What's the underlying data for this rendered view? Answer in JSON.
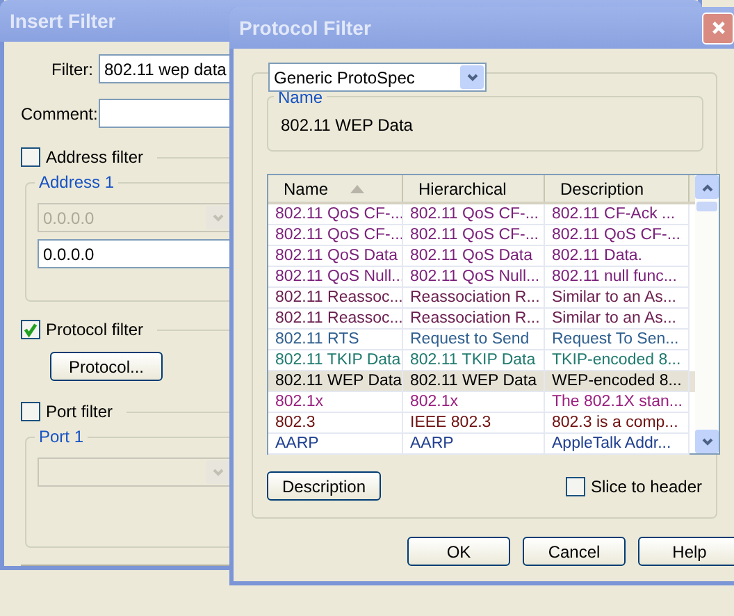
{
  "back_window": {
    "title": "Insert Filter",
    "filter": {
      "label": "Filter:",
      "value": "802.11 wep data"
    },
    "comment": {
      "label": "Comment:"
    },
    "address_filter": {
      "label": "Address filter",
      "checked": false
    },
    "address_group": {
      "title": "Address 1",
      "combo_value": "0.0.0.0",
      "combo_disabled": true,
      "field_value": "0.0.0.0"
    },
    "protocol_filter": {
      "label": "Protocol filter",
      "checked": true
    },
    "protocol_button": "Protocol...",
    "port_filter": {
      "label": "Port filter",
      "checked": false
    },
    "port_group": {
      "title": "Port 1",
      "combo_disabled": true
    }
  },
  "front_window": {
    "title": "Protocol Filter",
    "spec_combo": "Generic ProtoSpec",
    "name_group": {
      "title": "Name",
      "value": "802.11 WEP Data"
    },
    "table": {
      "columns": [
        {
          "label": "Name",
          "sorted": true
        },
        {
          "label": "Hierarchical",
          "sorted": false
        },
        {
          "label": "Description",
          "sorted": false
        }
      ],
      "rows": [
        {
          "cells": [
            "802.11 QoS CF-...",
            "802.11 QoS CF-...",
            "802.11 CF-Ack ..."
          ],
          "color": "#7a1f7a",
          "selected": false
        },
        {
          "cells": [
            "802.11 QoS CF-...",
            "802.11 QoS CF-...",
            "802.11 QoS CF-..."
          ],
          "color": "#7a1f7a",
          "selected": false
        },
        {
          "cells": [
            "802.11 QoS Data",
            "802.11 QoS Data",
            "802.11 Data."
          ],
          "color": "#7a1f7a",
          "selected": false
        },
        {
          "cells": [
            "802.11 QoS Null...",
            "802.11 QoS Null...",
            "802.11 null func..."
          ],
          "color": "#7a1f7a",
          "selected": false
        },
        {
          "cells": [
            "802.11 Reassoc...",
            "Reassociation R...",
            "Similar to an As..."
          ],
          "color": "#6b1f4f",
          "selected": false
        },
        {
          "cells": [
            "802.11 Reassoc...",
            "Reassociation R...",
            "Similar to an As..."
          ],
          "color": "#6b1f4f",
          "selected": false
        },
        {
          "cells": [
            "802.11 RTS",
            "Request to Send",
            "Request To Sen..."
          ],
          "color": "#2f5f8f",
          "selected": false
        },
        {
          "cells": [
            "802.11 TKIP Data",
            "802.11 TKIP Data",
            "TKIP-encoded 8..."
          ],
          "color": "#1f7a6f",
          "selected": false
        },
        {
          "cells": [
            "802.11 WEP Data",
            "802.11 WEP Data",
            "WEP-encoded 8..."
          ],
          "color": "#000000",
          "selected": true
        },
        {
          "cells": [
            "802.1x",
            "802.1x",
            "The 802.1X stan..."
          ],
          "color": "#9a207f",
          "selected": false
        },
        {
          "cells": [
            "802.3",
            "IEEE 802.3",
            "802.3 is a comp..."
          ],
          "color": "#6f1010",
          "selected": false
        },
        {
          "cells": [
            "AARP",
            "AARP",
            "AppleTalk Addr..."
          ],
          "color": "#1f3f8f",
          "selected": false
        }
      ]
    },
    "description_button": "Description",
    "slice_checkbox": {
      "label": "Slice to header",
      "checked": false
    },
    "buttons": [
      "OK",
      "Cancel",
      "Help"
    ]
  }
}
